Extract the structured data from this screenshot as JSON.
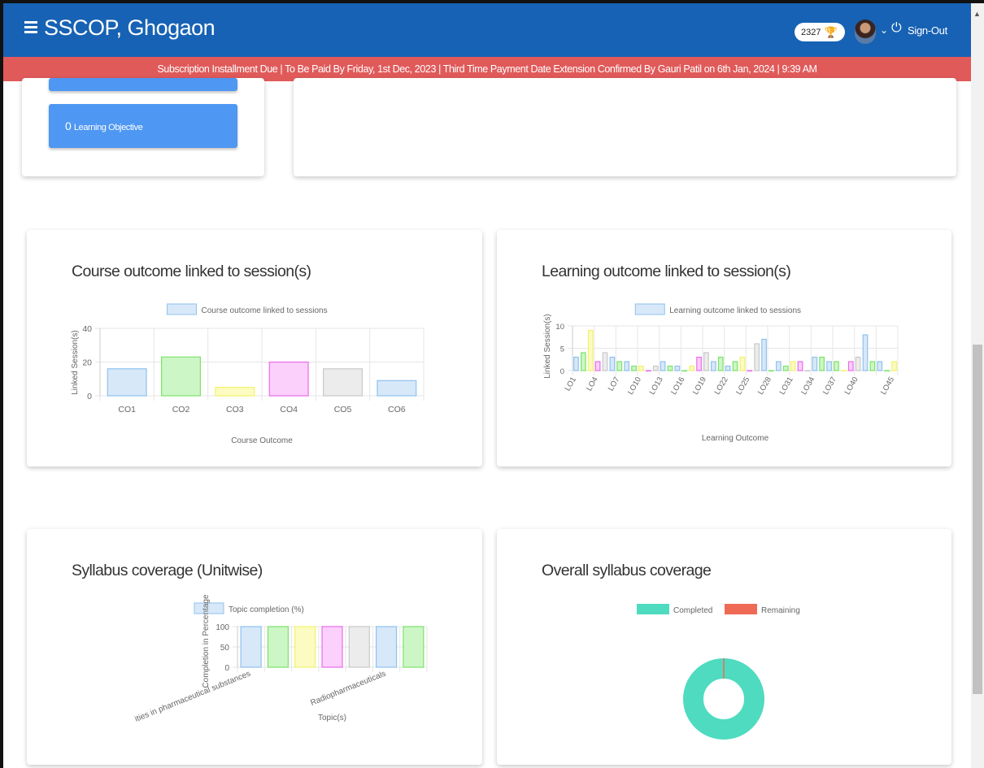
{
  "header": {
    "title": "SSCOP, Ghogaon",
    "points": "2327",
    "signout_label": "Sign-Out",
    "icons": [
      "menu-icon",
      "trophy-icon",
      "avatar",
      "chevron-down-icon",
      "power-icon"
    ]
  },
  "notice": {
    "text": "Subscription Installment Due | To Be Paid By Friday, 1st Dec, 2023 | Third Time Payment Date Extension Confirmed By Gauri Patil on 6th Jan, 2024 | 9:39 AM",
    "color": "#e05a5a"
  },
  "stats": {
    "learning_objective_count": "0",
    "learning_objective_label": "Learning Objective"
  },
  "colors": {
    "header": "#1762b4",
    "stat_button": "#4e97f2",
    "palette_fill": [
      "#d7e8f9",
      "#cdf6c6",
      "#fbfbc2",
      "#fbd0fb",
      "#ececec",
      "#d7e8f9",
      "#cdf6c6"
    ],
    "palette_stroke": [
      "#8fc2ee",
      "#7ce36a",
      "#f2f26b",
      "#ea6cea",
      "#c9c9c9",
      "#8fc2ee",
      "#7ce36a"
    ]
  },
  "cards": {
    "course_outcome": {
      "title": "Course outcome linked to session(s)"
    },
    "learning_outcome": {
      "title": "Learning outcome linked to session(s)"
    },
    "syllabus_unitwise": {
      "title": "Syllabus coverage (Unitwise)"
    },
    "overall": {
      "title": "Overall syllabus coverage"
    }
  },
  "chart_data": [
    {
      "id": "co",
      "type": "bar",
      "title": "",
      "legend": [
        "Course outcome linked to sessions"
      ],
      "categories": [
        "CO1",
        "CO2",
        "CO3",
        "CO4",
        "CO5",
        "CO6"
      ],
      "values": [
        16,
        23,
        5,
        20,
        16,
        9
      ],
      "xlabel": "Course Outcome",
      "ylabel": "Linked Session(s)",
      "yticks": [
        "0",
        "20",
        "40"
      ],
      "ylim": [
        0,
        40
      ]
    },
    {
      "id": "lo",
      "type": "bar",
      "title": "",
      "legend": [
        "Learning outcome linked to sessions"
      ],
      "categories": [
        "LO1",
        "LO2",
        "LO3",
        "LO4",
        "LO5",
        "LO6",
        "LO7",
        "LO8",
        "LO9",
        "LO10",
        "LO11",
        "LO12",
        "LO13",
        "LO14",
        "LO15",
        "LO16",
        "LO17",
        "LO18",
        "LO19",
        "LO20",
        "LO21",
        "LO22",
        "LO23",
        "LO24",
        "LO25",
        "LO26",
        "LO27",
        "LO28",
        "LO29",
        "LO30",
        "LO31",
        "LO32",
        "LO33",
        "LO34",
        "LO35",
        "LO36",
        "LO37",
        "LO38",
        "LO39",
        "LO40",
        "LO41",
        "LO42",
        "LO43",
        "LO44",
        "LO45"
      ],
      "xticks": [
        "LO1",
        "LO4",
        "LO7",
        "LO10",
        "LO13",
        "LO16",
        "LO19",
        "LO22",
        "LO25",
        "LO28",
        "LO31",
        "LO34",
        "LO37",
        "LO40",
        "LO45"
      ],
      "values": [
        3,
        4,
        9,
        2,
        4,
        3,
        2,
        2,
        1,
        1,
        0,
        1,
        2,
        1,
        1,
        0,
        1,
        3,
        4,
        2,
        3,
        1,
        2,
        3,
        0,
        6,
        7,
        0,
        2,
        1,
        2,
        2,
        0,
        3,
        3,
        2,
        2,
        0,
        2,
        3,
        8,
        2,
        2,
        0,
        2
      ],
      "xlabel": "Learning Outcome",
      "ylabel": "Linked Session(s)",
      "yticks": [
        "0",
        "5",
        "10"
      ],
      "ylim": [
        0,
        10
      ]
    },
    {
      "id": "syl",
      "type": "bar",
      "title": "",
      "legend": [
        "Topic completion (%)"
      ],
      "categories": [
        "ities in pharmaceutical substances",
        "",
        "",
        "",
        "",
        "Radiopharmaceuticals",
        ""
      ],
      "values": [
        100,
        100,
        100,
        100,
        100,
        100,
        100
      ],
      "xlabel": "Topic(s)",
      "ylabel": "Completion in Percentage",
      "yticks": [
        "0",
        "50",
        "100"
      ],
      "ylim": [
        0,
        100
      ]
    },
    {
      "id": "overall",
      "type": "pie",
      "title": "",
      "legend": [
        "Completed",
        "Remaining"
      ],
      "values": [
        100,
        0
      ],
      "colors": [
        "#4fdbbf",
        "#ef6a55"
      ]
    }
  ]
}
